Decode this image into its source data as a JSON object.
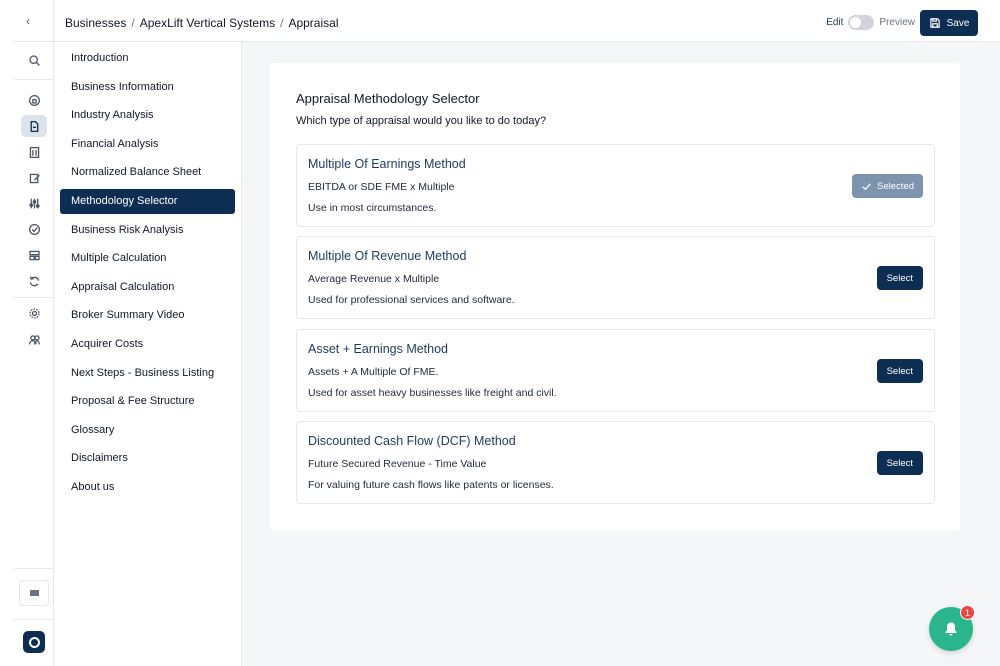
{
  "rail": {
    "collapse_glyph": "‹",
    "icons": [
      "search-icon",
      "home-icon",
      "document-icon",
      "building-icon",
      "edit-note-icon",
      "sliders-icon",
      "check-circle-icon",
      "layout-icon",
      "refresh-icon",
      "gear-icon",
      "users-icon"
    ]
  },
  "breadcrumb": {
    "items": [
      "Businesses",
      "ApexLift Vertical Systems",
      "Appraisal"
    ],
    "separator": "/"
  },
  "mode": {
    "edit_label": "Edit",
    "preview_label": "Preview"
  },
  "toolbar": {
    "save_label": "Save"
  },
  "sections": [
    "Introduction",
    "Business Information",
    "Industry Analysis",
    "Financial Analysis",
    "Normalized Balance Sheet",
    "Methodology Selector",
    "Business Risk Analysis",
    "Multiple Calculation",
    "Appraisal Calculation",
    "Broker Summary Video",
    "Acquirer Costs",
    "Next Steps - Business Listing",
    "Proposal & Fee Structure",
    "Glossary",
    "Disclaimers",
    "About us"
  ],
  "active_section": "Methodology Selector",
  "main": {
    "title": "Appraisal Methodology Selector",
    "subtitle": "Which type of appraisal would you like to do today?",
    "methods": [
      {
        "title": "Multiple Of Earnings Method",
        "formula": "EBITDA or SDE FME x Multiple",
        "description": "Use in most circumstances.",
        "button": "Selected",
        "selected": true
      },
      {
        "title": "Multiple Of Revenue Method",
        "formula": "Average Revenue x Multiple",
        "description": "Used for professional services and software.",
        "button": "Select",
        "selected": false
      },
      {
        "title": "Asset + Earnings Method",
        "formula": "Assets + A Multiple Of FME.",
        "description": "Used for asset heavy businesses like freight and civil.",
        "button": "Select",
        "selected": false
      },
      {
        "title": "Discounted Cash Flow (DCF) Method",
        "formula": "Future Secured Revenue - Time Value",
        "description": "For valuing future cash flows like patents or licenses.",
        "button": "Select",
        "selected": false
      }
    ]
  },
  "notifications": {
    "count": "1"
  },
  "colors": {
    "primary": "#0d2d52",
    "selected_button": "#7d93ae",
    "fab": "#2ab58c",
    "badge": "#ef4444"
  }
}
